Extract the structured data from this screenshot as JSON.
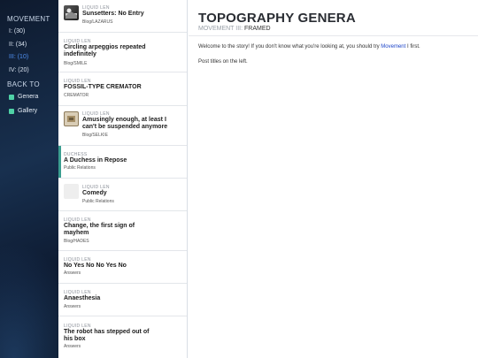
{
  "sidebar": {
    "movement_heading": "MOVEMENT",
    "movements": [
      {
        "label": "I: (30)"
      },
      {
        "label": "II: (34)"
      },
      {
        "label": "III: (10)"
      },
      {
        "label": "IV: (20)"
      }
    ],
    "back_heading": "BACK TO",
    "links": [
      {
        "label": "Genera"
      },
      {
        "label": "Gallery"
      }
    ],
    "accent_color": "#4fd1a6",
    "active_color": "#4f8ff0"
  },
  "posts": [
    {
      "author": "LIQUID LEN",
      "title": "Sunsetters: No Entry",
      "meta": "Blog/LAZARUS"
    },
    {
      "author": "LIQUID LEN",
      "title": "Circling arpeggios repeated indefinitely",
      "meta": "Blog/SMILE"
    },
    {
      "author": "LIQUID LEN",
      "title": "FOSSIL-TYPE CREMATOR",
      "meta": "CREMATOR"
    },
    {
      "author": "LIQUID LEN",
      "title": "Amusingly enough, at least I can't be suspended anymore",
      "meta": "Blog/SELKIE"
    },
    {
      "author": "DUCHESS",
      "title": "A Duchess in Repose",
      "meta": "Public Relations"
    },
    {
      "author": "LIQUID LEN",
      "title": "Comedy",
      "meta": "Public Relations"
    },
    {
      "author": "LIQUID LEN",
      "title": "Change, the first sign of mayhem",
      "meta": "Blog/HADES"
    },
    {
      "author": "LIQUID LEN",
      "title": "No Yes No No Yes No",
      "meta": "Answers"
    },
    {
      "author": "LIQUID LEN",
      "title": "Anaesthesia",
      "meta": "Answers"
    },
    {
      "author": "LIQUID LEN",
      "title": "The robot has stepped out of his box",
      "meta": "Answers"
    }
  ],
  "main": {
    "title": "TOPOGRAPHY GENERA",
    "subtitle_prefix": "MOVEMENT III:",
    "subtitle_value": "FRAMED",
    "intro_before": "Welcome to the story! If you don't know what you're looking at, you should try",
    "intro_link": "Movement",
    "intro_after": "I first.",
    "instructions": "Post titles on the left.",
    "link_color": "#1c44c9"
  }
}
